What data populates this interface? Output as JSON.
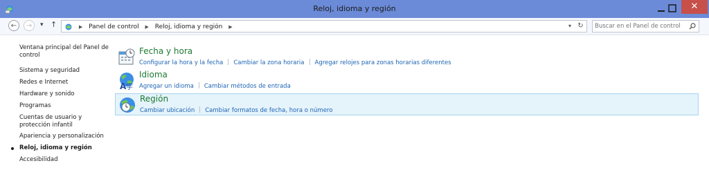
{
  "window": {
    "title": "Reloj, idioma y región",
    "close_glyph": "✕",
    "title_bar_color": "#6b8bd8",
    "close_button_color": "#c7504a"
  },
  "navigation": {
    "back_glyph": "←",
    "forward_glyph": "→",
    "recent_glyph": "▾",
    "up_glyph": "↑",
    "breadcrumbs": [
      "Panel de control",
      "Reloj, idioma y región"
    ],
    "crumb_separator": "▶",
    "dropdown_glyph": "▾",
    "refresh_glyph": "↻"
  },
  "search": {
    "placeholder": "Buscar en el Panel de control"
  },
  "sidebar": {
    "items": [
      {
        "label": "Ventana principal del Panel de control",
        "current": false
      },
      {
        "label": "Sistema y seguridad",
        "current": false
      },
      {
        "label": "Redes e Internet",
        "current": false
      },
      {
        "label": "Hardware y sonido",
        "current": false
      },
      {
        "label": "Programas",
        "current": false
      },
      {
        "label": "Cuentas de usuario y protección infantil",
        "current": false
      },
      {
        "label": "Apariencia y personalización",
        "current": false
      },
      {
        "label": "Reloj, idioma y región",
        "current": true
      },
      {
        "label": "Accesibilidad",
        "current": false
      }
    ]
  },
  "categories": [
    {
      "title": "Fecha y hora",
      "icon": "date-time-icon",
      "links": [
        "Configurar la hora y la fecha",
        "Cambiar la zona horaria",
        "Agregar relojes para zonas horarias diferentes"
      ]
    },
    {
      "title": "Idioma",
      "icon": "language-icon",
      "links": [
        "Agregar un idioma",
        "Cambiar métodos de entrada"
      ]
    },
    {
      "title": "Región",
      "icon": "region-icon",
      "selected": true,
      "links": [
        "Cambiar ubicación",
        "Cambiar formatos de fecha, hora o número"
      ]
    }
  ],
  "colors": {
    "link": "#1e64b4",
    "category_title": "#1e7a32",
    "selection_bg": "#e5f3fb",
    "selection_border": "#a8d5ef"
  }
}
